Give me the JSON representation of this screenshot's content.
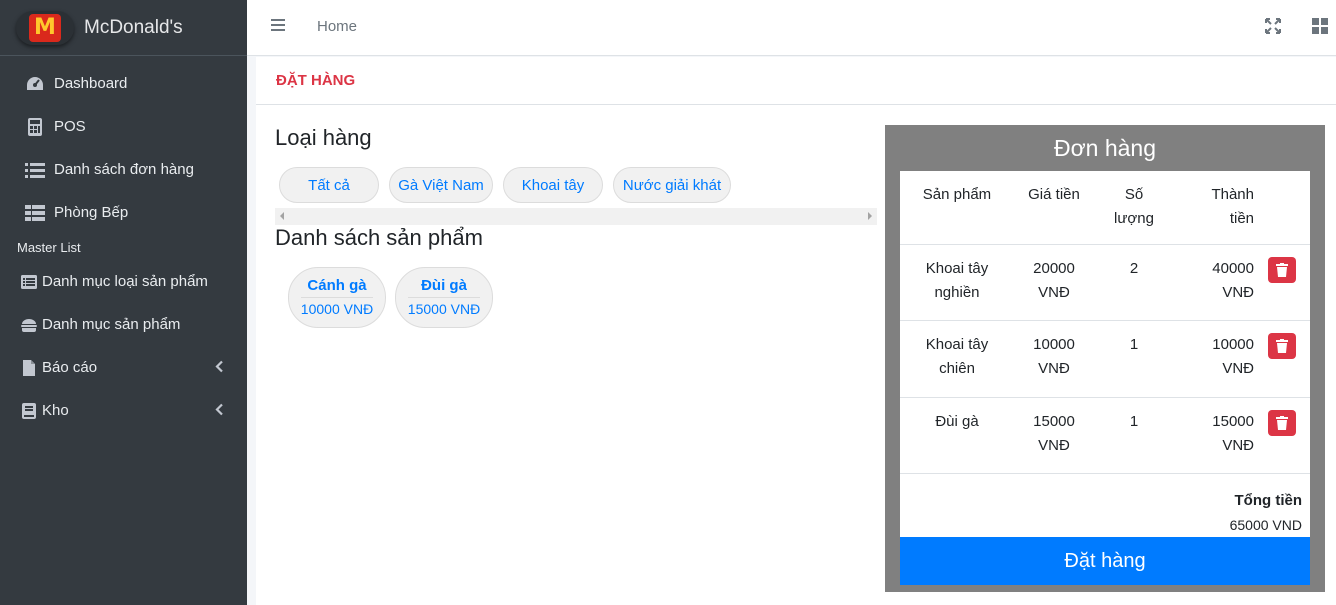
{
  "brand": {
    "name": "McDonald's",
    "logo_letter": "M"
  },
  "sidebar": {
    "items": [
      {
        "label": "Dashboard",
        "icon": "dashboard-icon"
      },
      {
        "label": "POS",
        "icon": "calculator-icon"
      },
      {
        "label": "Danh sách đơn hàng",
        "icon": "list-icon"
      },
      {
        "label": "Phòng Bếp",
        "icon": "table-icon"
      }
    ],
    "header": "Master List",
    "master_items": [
      {
        "label": "Danh mục loại sản phẩm",
        "icon": "list-alt-icon"
      },
      {
        "label": "Danh mục sản phẩm",
        "icon": "hamburger-icon"
      },
      {
        "label": "Báo cáo",
        "icon": "file-icon"
      },
      {
        "label": "Kho",
        "icon": "book-icon"
      }
    ]
  },
  "topbar": {
    "home": "Home"
  },
  "page": {
    "title": "ĐẶT HÀNG"
  },
  "categories": {
    "title": "Loại hàng",
    "items": [
      "Tất cả",
      "Gà Việt Nam",
      "Khoai tây",
      "Nước giải khát"
    ]
  },
  "products": {
    "title": "Danh sách sản phẩm",
    "items": [
      {
        "name": "Cánh gà",
        "price": "10000 VNĐ"
      },
      {
        "name": "Đùi gà",
        "price": "15000 VNĐ"
      }
    ]
  },
  "order": {
    "title": "Đơn hàng",
    "columns": [
      "Sản phẩm",
      "Giá tiền",
      "Số lượng",
      "Thành tiền"
    ],
    "rows": [
      {
        "product": "Khoai tây nghiền",
        "price": "20000 VNĐ",
        "qty": "2",
        "total": "40000 VNĐ"
      },
      {
        "product": "Khoai tây chiên",
        "price": "10000 VNĐ",
        "qty": "1",
        "total": "10000 VNĐ"
      },
      {
        "product": "Đùi gà",
        "price": "15000 VNĐ",
        "qty": "1",
        "total": "15000 VNĐ"
      }
    ],
    "total_label": "Tổng tiền",
    "total_value": "65000 VND",
    "submit_label": "Đặt hàng"
  }
}
